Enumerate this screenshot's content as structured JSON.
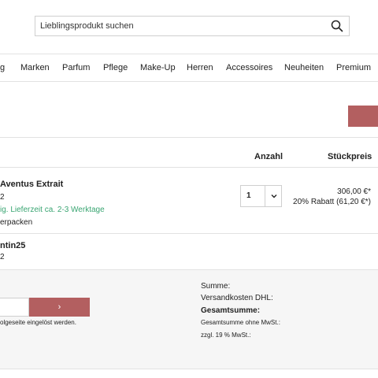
{
  "search": {
    "placeholder": "Lieblingsprodukt suchen"
  },
  "nav": {
    "items": [
      "g",
      "Marken",
      "Parfum",
      "Pflege",
      "Make-Up",
      "Herren",
      "Accessoires",
      "Neuheiten",
      "Premium"
    ]
  },
  "table": {
    "headers": {
      "quantity": "Anzahl",
      "unit_price": "Stückpreis"
    }
  },
  "product": {
    "name": "Aventus Extrait",
    "line2": "2",
    "delivery": "ig. Lieferzeit ca. 2-3 Werktage",
    "gift_wrap": "erpacken",
    "quantity": "1",
    "price": "306,00 €*",
    "discount": "20% Rabatt (61,20 €*)"
  },
  "coupon": {
    "code": "ntin25",
    "line2": "2"
  },
  "voucher": {
    "button_icon": "›",
    "note": "olgeseite eingelöst werden."
  },
  "summary": {
    "subtotal": "Summe:",
    "shipping": "Versandkosten DHL:",
    "total": "Gesamtsumme:",
    "net": "Gesamtsumme ohne MwSt.:",
    "vat": "zzgl. 19 % MwSt.:"
  },
  "colors": {
    "accent": "#b35f60",
    "delivery_green": "#3aa572"
  }
}
